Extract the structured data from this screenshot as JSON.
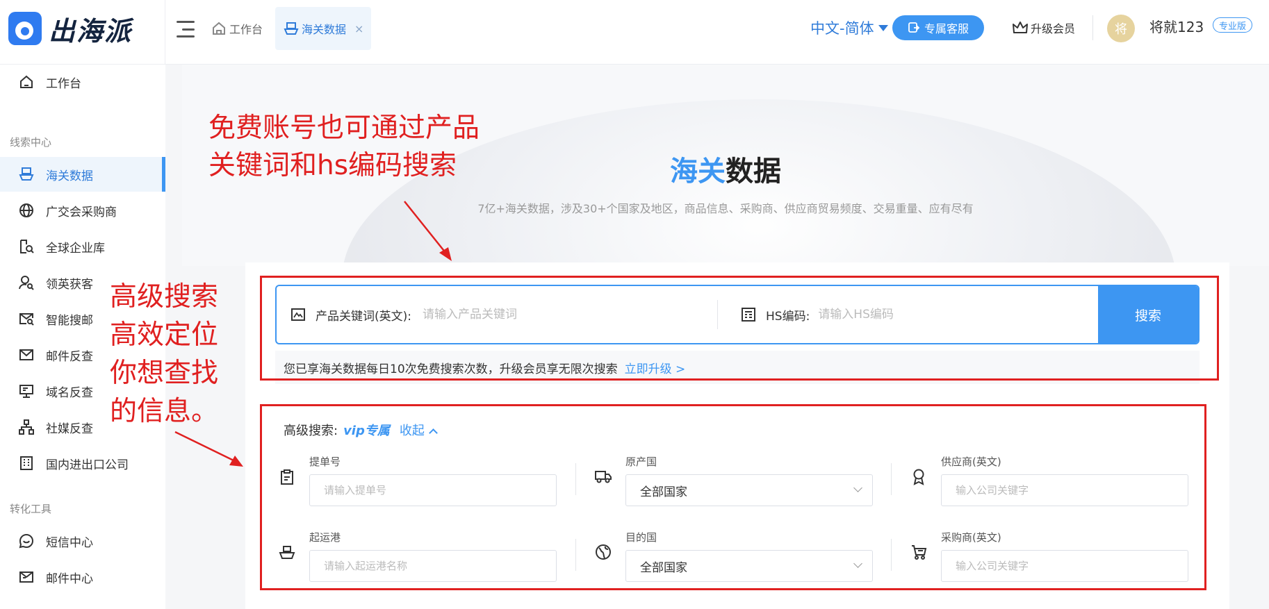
{
  "brand": {
    "name": "出海派",
    "accent": "#3d96f2"
  },
  "topbar": {
    "tabs": [
      {
        "label": "工作台",
        "icon": "home-icon"
      },
      {
        "label": "海关数据",
        "icon": "ship-icon",
        "close": "×"
      }
    ],
    "language": "中文-简体",
    "service_label": "专属客服",
    "upgrade_label": "升级会员",
    "avatar_letter": "将",
    "username": "将就123",
    "edition": "专业版"
  },
  "sidebar": {
    "workbench": "工作台",
    "section_leads": "线索中心",
    "items": [
      {
        "label": "海关数据",
        "icon": "ship-icon"
      },
      {
        "label": "广交会采购商",
        "icon": "globe-icon"
      },
      {
        "label": "全球企业库",
        "icon": "company-search-icon"
      },
      {
        "label": "领英获客",
        "icon": "user-search-icon"
      },
      {
        "label": "智能搜邮",
        "icon": "mail-search-icon"
      },
      {
        "label": "邮件反查",
        "icon": "mail-icon"
      },
      {
        "label": "域名反查",
        "icon": "monitor-icon"
      },
      {
        "label": "社媒反查",
        "icon": "network-icon"
      },
      {
        "label": "国内进出口公司",
        "icon": "building-icon"
      }
    ],
    "section_tools": "转化工具",
    "tools": [
      {
        "label": "短信中心",
        "icon": "chat-icon"
      },
      {
        "label": "邮件中心",
        "icon": "send-mail-icon"
      }
    ]
  },
  "hero": {
    "title_highlight": "海关",
    "title_rest": "数据",
    "subtitle": "7亿+海关数据，涉及30+个国家及地区，商品信息、采购商、供应商贸易频度、交易重量、应有尽有"
  },
  "search": {
    "keyword_label": "产品关键词(英文):",
    "keyword_placeholder": "请输入产品关键词",
    "hs_label": "HS编码:",
    "hs_placeholder": "请输入HS编码",
    "button": "搜索",
    "quota_text": "您已享海关数据每日10次免费搜索次数，升级会员享无限次搜索",
    "upgrade_link": "立即升级 >"
  },
  "advanced": {
    "label": "高级搜索:",
    "vip": "vip专属",
    "collapse": "收起",
    "fields": [
      {
        "label": "提单号",
        "placeholder": "请输入提单号",
        "icon": "clipboard-icon"
      },
      {
        "label": "原产国",
        "value": "全部国家",
        "icon": "truck-icon"
      },
      {
        "label": "供应商(英文)",
        "placeholder": "输入公司关键字",
        "icon": "award-icon"
      },
      {
        "label": "起运港",
        "placeholder": "请输入起运港名称",
        "icon": "boat-icon"
      },
      {
        "label": "目的国",
        "value": "全部国家",
        "icon": "globe-icon"
      },
      {
        "label": "采购商(英文)",
        "placeholder": "输入公司关键字",
        "icon": "cart-icon"
      }
    ]
  },
  "annotations": {
    "top_note": [
      "免费账号也可通过产品",
      "关键词和hs编码搜索"
    ],
    "side_note": [
      "高级搜索",
      "高效定位",
      "你想查找",
      "的信息。"
    ],
    "color": "#e02020"
  }
}
